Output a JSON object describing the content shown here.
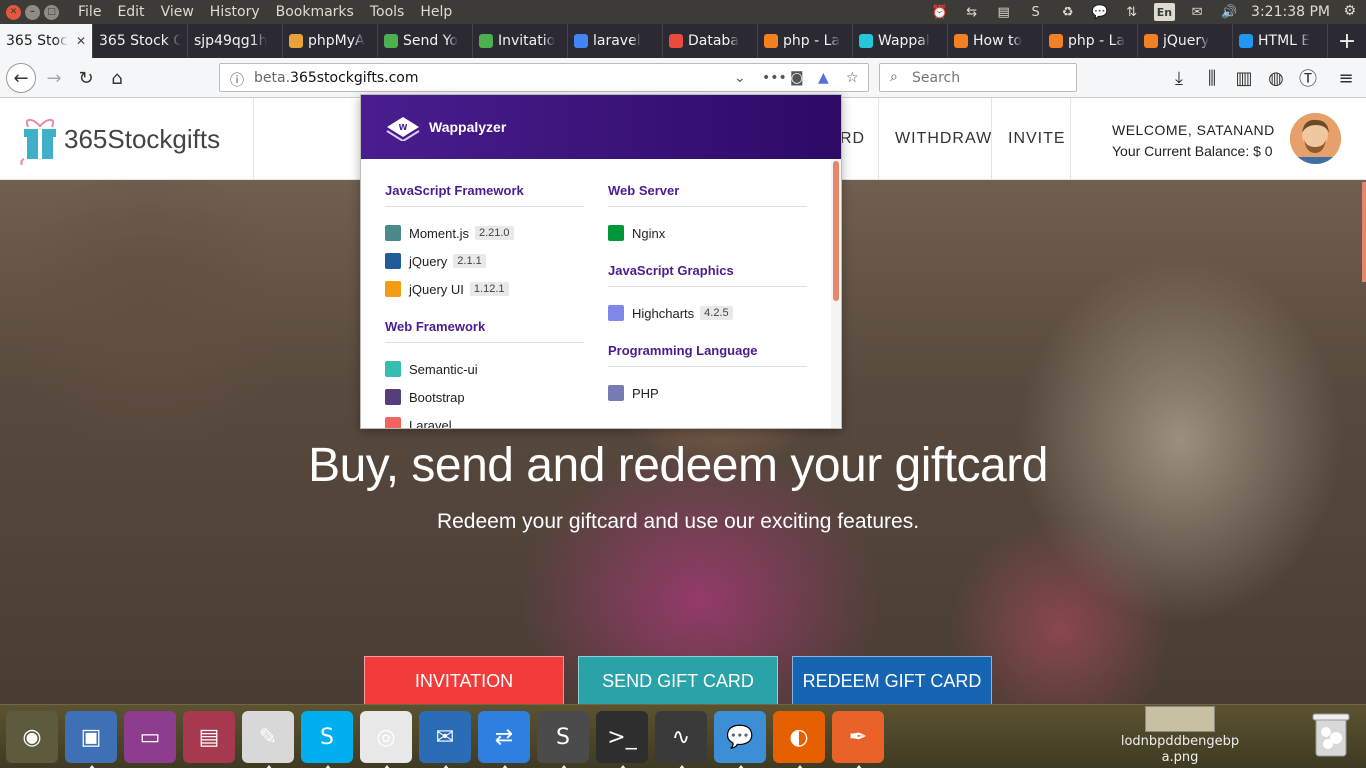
{
  "os_panel": {
    "menu": [
      "File",
      "Edit",
      "View",
      "History",
      "Bookmarks",
      "Tools",
      "Help"
    ],
    "language": "En",
    "clock": "3:21:38 PM"
  },
  "tabs": [
    {
      "label": "365 Stoc",
      "icon": "blank-icon",
      "color": "#f5f6f7",
      "active": true
    },
    {
      "label": "365 Stock C",
      "icon": "blank-icon",
      "color": "#2b2a33"
    },
    {
      "label": "sjp49qg1h",
      "icon": "blank-icon",
      "color": "#2b2a33"
    },
    {
      "label": "phpMyA",
      "icon": "phpmyadmin-icon",
      "color": "#e8a23a"
    },
    {
      "label": "Send Yo",
      "icon": "green-e-icon",
      "color": "#4caf50"
    },
    {
      "label": "Invitatio",
      "icon": "green-e-icon",
      "color": "#4caf50"
    },
    {
      "label": "laravel",
      "icon": "google-icon",
      "color": "#4285f4"
    },
    {
      "label": "Databa",
      "icon": "laravel-icon",
      "color": "#e74c3c"
    },
    {
      "label": "php - La",
      "icon": "stackoverflow-icon",
      "color": "#f48024"
    },
    {
      "label": "Wappal",
      "icon": "wappalyzer-icon",
      "color": "#26c6da"
    },
    {
      "label": "How to",
      "icon": "stackoverflow-icon",
      "color": "#f48024"
    },
    {
      "label": "php - La",
      "icon": "stackoverflow-icon",
      "color": "#f48024"
    },
    {
      "label": "jQuery",
      "icon": "stackoverflow-icon",
      "color": "#f48024"
    },
    {
      "label": "HTML E",
      "icon": "w3-icon",
      "color": "#2196f3"
    }
  ],
  "nav": {
    "url_prefix": "beta.",
    "url_domain": "365stockgifts.com",
    "search_placeholder": "Search"
  },
  "site": {
    "logo": "365Stockgifts",
    "nav_links": [
      "RD",
      "WITHDRAW",
      "INVITE"
    ],
    "welcome": "WELCOME, SATANAND",
    "balance": "Your Current Balance: $ 0",
    "hero_title": "Buy, send and redeem your giftcard",
    "hero_subtitle": "Redeem your giftcard and use our exciting features.",
    "buttons": [
      {
        "label": "INVITATION",
        "color": "#f23b3b"
      },
      {
        "label": "SEND GIFT CARD",
        "color": "#2aa3a8"
      },
      {
        "label": "REDEEM GIFT CARD",
        "color": "#1565b3"
      }
    ]
  },
  "wappalyzer": {
    "title": "Wappalyzer",
    "left": [
      {
        "category": "JavaScript Framework",
        "apps": [
          {
            "name": "Moment.js",
            "version": "2.21.0",
            "icon": "moment-icon",
            "color": "#4a8a8a"
          },
          {
            "name": "jQuery",
            "version": "2.1.1",
            "icon": "jquery-icon",
            "color": "#1f5c99"
          },
          {
            "name": "jQuery UI",
            "version": "1.12.1",
            "icon": "jqueryui-icon",
            "color": "#f39c12"
          }
        ]
      },
      {
        "category": "Web Framework",
        "apps": [
          {
            "name": "Semantic-ui",
            "version": "",
            "icon": "semantic-icon",
            "color": "#35bdb2"
          },
          {
            "name": "Bootstrap",
            "version": "",
            "icon": "bootstrap-icon",
            "color": "#563d7c"
          },
          {
            "name": "Laravel",
            "version": "",
            "icon": "laravel-icon",
            "color": "#f4645f"
          }
        ]
      }
    ],
    "right": [
      {
        "category": "Web Server",
        "apps": [
          {
            "name": "Nginx",
            "version": "",
            "icon": "nginx-icon",
            "color": "#009639"
          }
        ]
      },
      {
        "category": "JavaScript Graphics",
        "apps": [
          {
            "name": "Highcharts",
            "version": "4.2.5",
            "icon": "highcharts-icon",
            "color": "#8087e8"
          }
        ]
      },
      {
        "category": "Programming Language",
        "apps": [
          {
            "name": "PHP",
            "version": "",
            "icon": "php-icon",
            "color": "#777bb3"
          }
        ]
      }
    ]
  },
  "dock": {
    "items": [
      {
        "name": "ubuntu-icon",
        "color": "#5e5a3e"
      },
      {
        "name": "virtualbox-icon",
        "color": "#3f6fb5"
      },
      {
        "name": "workspace-icon",
        "color": "#8e3d8e"
      },
      {
        "name": "files-icon",
        "color": "#a6384f"
      },
      {
        "name": "text-editor-icon",
        "color": "#d8d8d8"
      },
      {
        "name": "skype-icon",
        "color": "#00aff0"
      },
      {
        "name": "chrome-icon",
        "color": "#e8e8e8"
      },
      {
        "name": "thunderbird-icon",
        "color": "#2a6cb5"
      },
      {
        "name": "teamviewer-icon",
        "color": "#2f7fe0"
      },
      {
        "name": "sublime-icon",
        "color": "#4b4b4b"
      },
      {
        "name": "terminal-icon",
        "color": "#2e2e2e"
      },
      {
        "name": "system-monitor-icon",
        "color": "#3a3a3a"
      },
      {
        "name": "chat-icon",
        "color": "#3c8fd6"
      },
      {
        "name": "firefox-icon",
        "color": "#e66000"
      },
      {
        "name": "inkscape-icon",
        "color": "#e8622a"
      }
    ],
    "desktop_file": "lodnbpddbengebp a.png"
  }
}
